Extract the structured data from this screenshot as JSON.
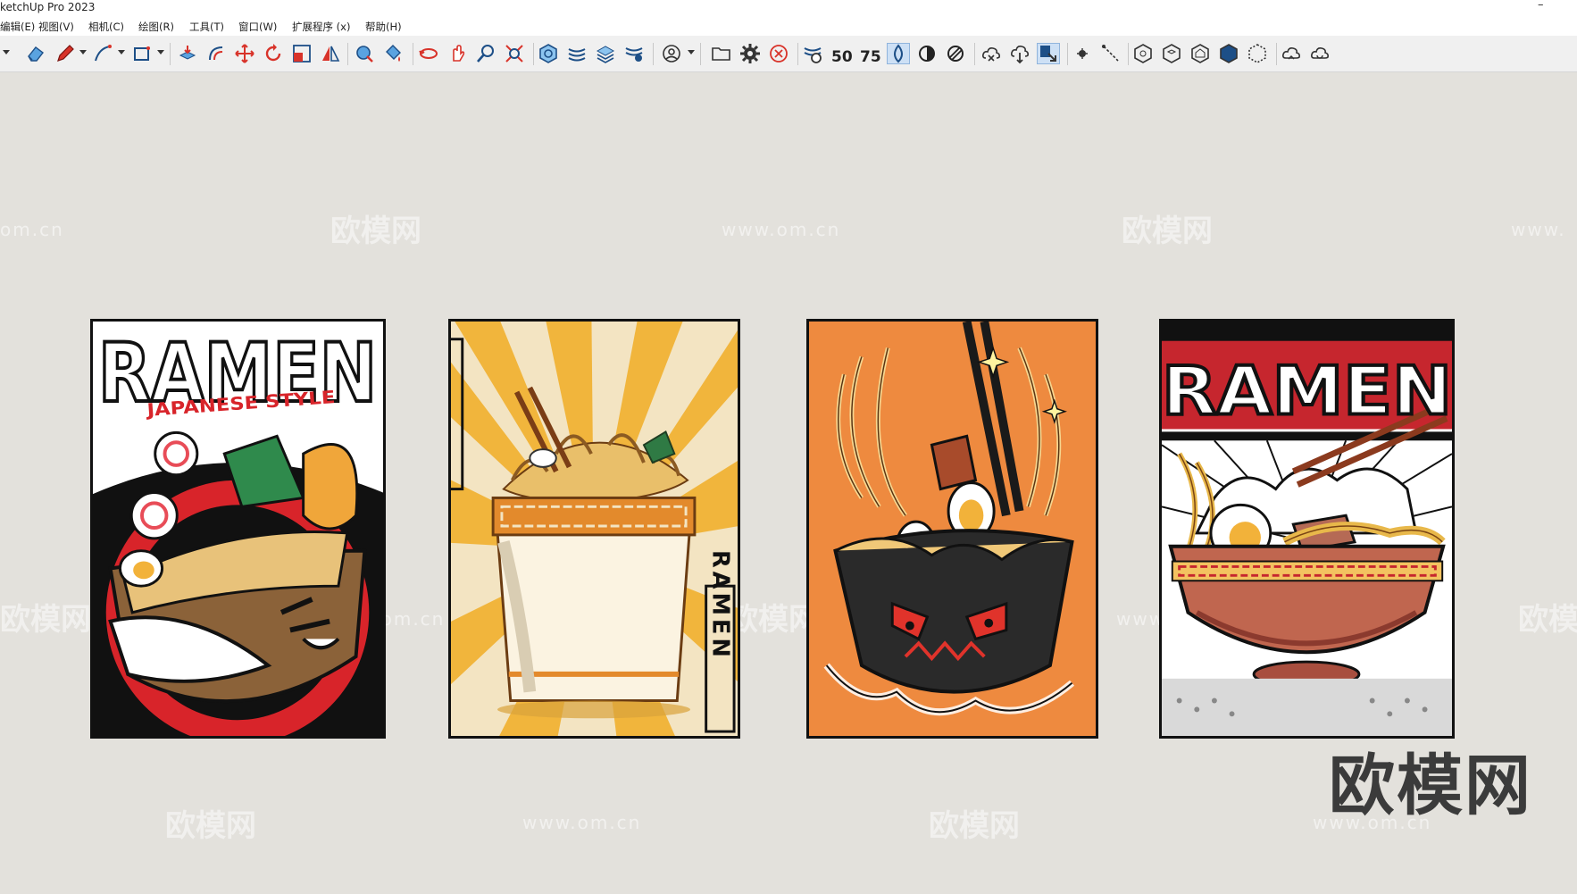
{
  "window": {
    "title": "ketchUp Pro 2023",
    "minimize_glyph": "–"
  },
  "menu": [
    "编辑(E)",
    "视图(V)",
    "相机(C)",
    "绘图(R)",
    "工具(T)",
    "窗口(W)",
    "扩展程序 (x)",
    "帮助(H)"
  ],
  "toolbar": {
    "icons": [
      "eraser-icon",
      "pencil-icon",
      "line-tool-icon",
      "rectangle-icon",
      "push-pull-icon",
      "offset-icon",
      "move-icon",
      "rotate-icon",
      "scale-icon",
      "mirror-icon",
      "tape-measure-icon",
      "paint-icon",
      "orbit-icon",
      "pan-icon",
      "zoom-icon",
      "zoom-extents-icon",
      "components-icon",
      "layers-icon",
      "materials-icon",
      "styles-icon",
      "account-icon",
      "open-folder-icon",
      "settings-gear-icon",
      "close-circle-icon",
      "warehouse-icon",
      "render-50-icon",
      "render-75-icon",
      "xray-icon",
      "back-edges-icon",
      "hidden-line-icon",
      "cloud-upload-icon",
      "cloud-download-icon",
      "share-icon",
      "point-icon",
      "dimension-icon",
      "view-iso-icon",
      "view-top-icon",
      "view-front-icon",
      "view-right-icon",
      "view-back-icon",
      "sync-cloud-icon",
      "sync-refresh-icon"
    ],
    "badge_50": "50",
    "badge_75": "75"
  },
  "watermark": {
    "url": "www.om.cn",
    "url_short": "om.cn",
    "logo": "欧模网",
    "url_partial": "www."
  },
  "brand": "欧模网",
  "posters": [
    {
      "name": "ramen-poster-japanese-style",
      "title": "RAMEN",
      "subtitle": "JAPANESE STYLE",
      "bg": "#ffffff",
      "accent": "#d8242a"
    },
    {
      "name": "ramen-poster-cup-noodle",
      "side_label": "RAMEN",
      "bg": "#f1b53c",
      "accent": "#e38a2c"
    },
    {
      "name": "ramen-poster-orange-monster-bowl",
      "bg": "#ee8a3f",
      "accent": "#222222"
    },
    {
      "name": "ramen-poster-red-bowl",
      "title": "RAMEN",
      "bg": "#ffffff",
      "accent": "#c6262e"
    }
  ]
}
